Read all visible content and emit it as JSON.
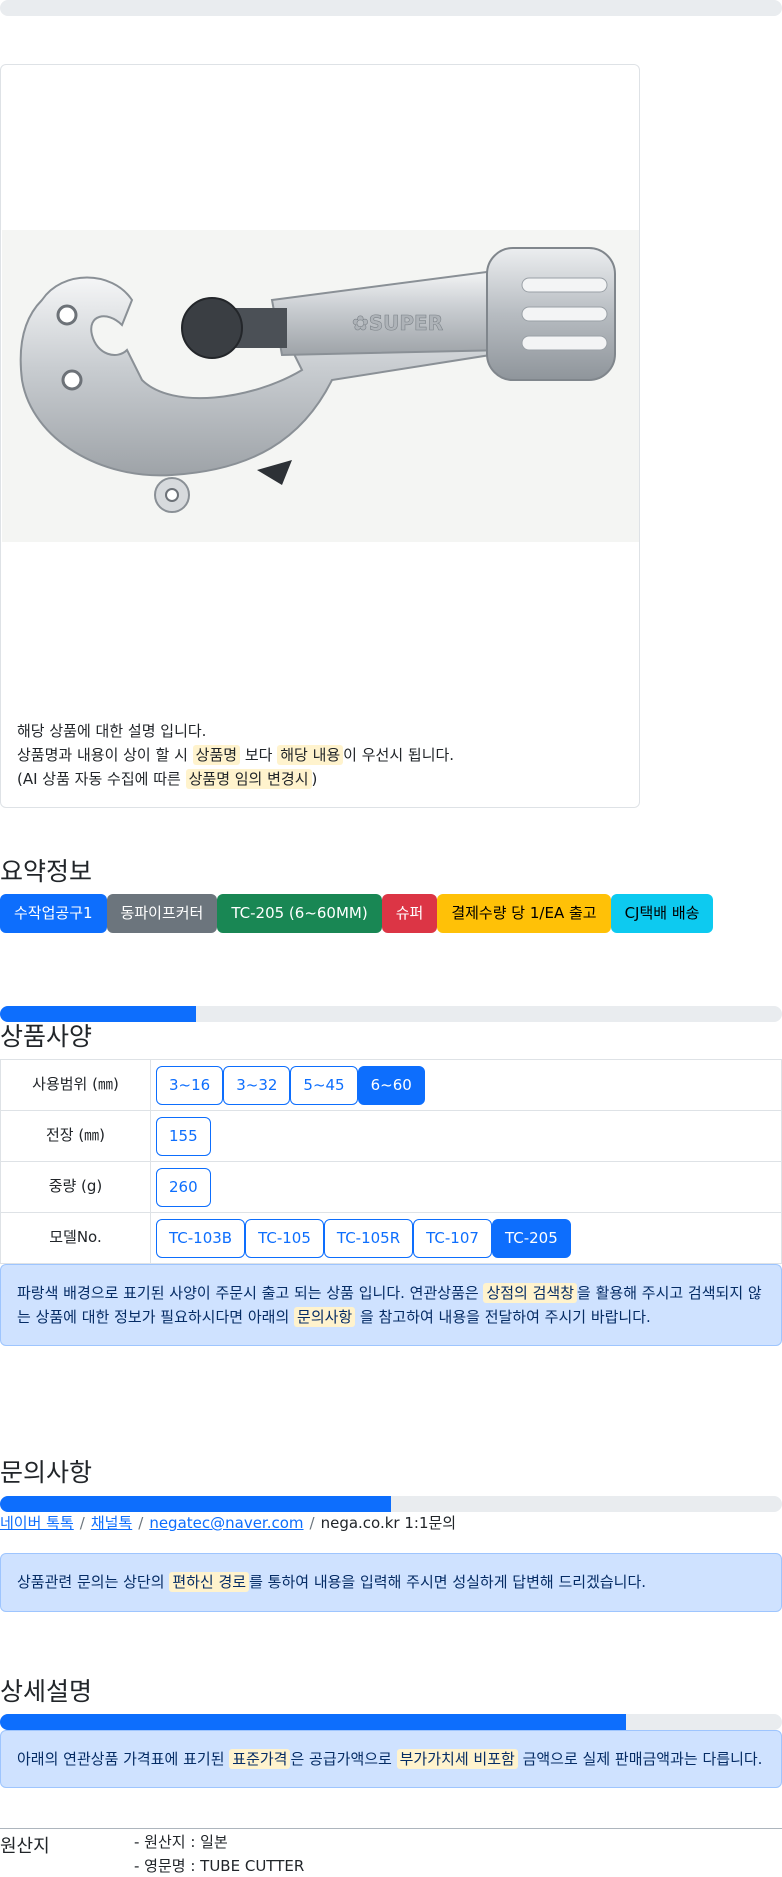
{
  "top_progress": {
    "value": 0
  },
  "product_card": {
    "image_alt": "TUBE CUTTER TC-205",
    "desc_line1": "해당 상품에 대한 설명 입니다.",
    "desc_line2": {
      "a": "상품명과 내용이 상이 할 시 ",
      "b": "상품명",
      "c": " 보다 ",
      "d": "해당 내용",
      "e": "이 우선시 됩니다."
    },
    "desc_line3": {
      "a": "(AI 상품 자동 수집에 따른 ",
      "b": "상품명 임의 변경시",
      "c": ")"
    }
  },
  "summary": {
    "title": "요약정보",
    "badges": [
      {
        "label": "수작업공구1",
        "color": "#0d6efd"
      },
      {
        "label": "동파이프커터",
        "color": "#6c757d"
      },
      {
        "label": "TC-205 (6~60MM)",
        "color": "#198754"
      },
      {
        "label": "슈퍼",
        "color": "#dc3545"
      },
      {
        "label": "결제수량 당 1/EA 출고",
        "color": "#ffc107"
      },
      {
        "label": "CJ택배 배송",
        "color": "#0dcaf0"
      }
    ]
  },
  "spec": {
    "progress": 0.25,
    "title": "상품사양",
    "rows": [
      {
        "label": "사용범위 (㎜)",
        "options": [
          "3~16",
          "3~32",
          "5~45",
          "6~60"
        ],
        "active": 3
      },
      {
        "label": "전장 (㎜)",
        "options": [
          "155"
        ],
        "active": -1
      },
      {
        "label": "중량 (g)",
        "options": [
          "260"
        ],
        "active": -1
      },
      {
        "label": "모델No.",
        "options": [
          "TC-103B",
          "TC-105",
          "TC-105R",
          "TC-107",
          "TC-205"
        ],
        "active": 4
      }
    ],
    "notice": {
      "a": "파랑색 배경으로 표기된 사양이 주문시 출고 되는 상품 입니다. 연관상품은 ",
      "b": "상점의 검색창",
      "c": "을 활용해 주시고 검색되지 않는 상품에 대한 정보가 필요하시다면 아래의 ",
      "d": "문의사항",
      "e": " 을 참고하여 내용을 전달하여 주시기 바랍니다."
    }
  },
  "inquiry": {
    "title": "문의사항",
    "progress": 0.5,
    "links": [
      "네이버 톡톡",
      "채널톡",
      "negatec@naver.com"
    ],
    "plain": "nega.co.kr 1:1문의",
    "separator": "/",
    "notice": {
      "a": "상품관련 문의는 상단의 ",
      "b": "편하신 경로",
      "c": "를 통하여 내용을 입력해 주시면 성실하게 답변해 드리겠습니다."
    }
  },
  "detail": {
    "title": "상세설명",
    "progress": 0.8,
    "notice": {
      "a": "아래의 연관상품 가격표에 표기된 ",
      "b": "표준가격",
      "c": "은 공급가액으로 ",
      "d": "부가가치세 비포함",
      "e": " 금액으로 실제 판매금액과는 다릅니다."
    }
  },
  "origin": {
    "label": "원산지",
    "items": [
      "- 원산지 : 일본",
      "- 영문명 : TUBE CUTTER"
    ]
  }
}
